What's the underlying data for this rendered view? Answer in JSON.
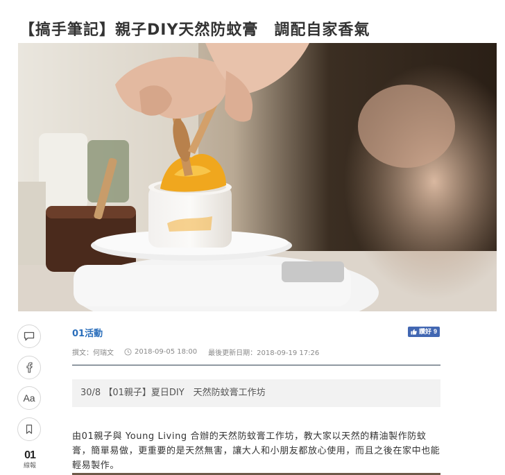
{
  "article": {
    "title": "【搞手筆記】親子DIY天然防蚊膏　調配自家香氣",
    "category": "01活動",
    "author": "撰文：何瑞文",
    "published": "2018-09-05 18:00",
    "updated": "最後更新日期：2018-09-19 17:26",
    "related_link": "30/8 【01親子】夏日DIY　天然防蚊膏工作坊",
    "body": "由01親子與 Young Living 合辦的天然防蚊膏工作坊，教大家以天然的精油製作防蚊膏，簡單易做，更重要的是天然無害，讓大人和小朋友都放心使用，而且之後在家中也能輕易製作。"
  },
  "like": {
    "label": "讚好",
    "count": "9"
  },
  "sidebar": {
    "icons": [
      "comment-icon",
      "facebook-icon",
      "font-size-icon",
      "bookmark-icon"
    ],
    "font_size_label": "Aa",
    "logo_mark": "01",
    "logo_label": "線報"
  },
  "colors": {
    "category": "#2a6ebb",
    "like_button": "#4267b2",
    "divider": "#2d3e50",
    "related_bg": "#f2f2f2"
  }
}
